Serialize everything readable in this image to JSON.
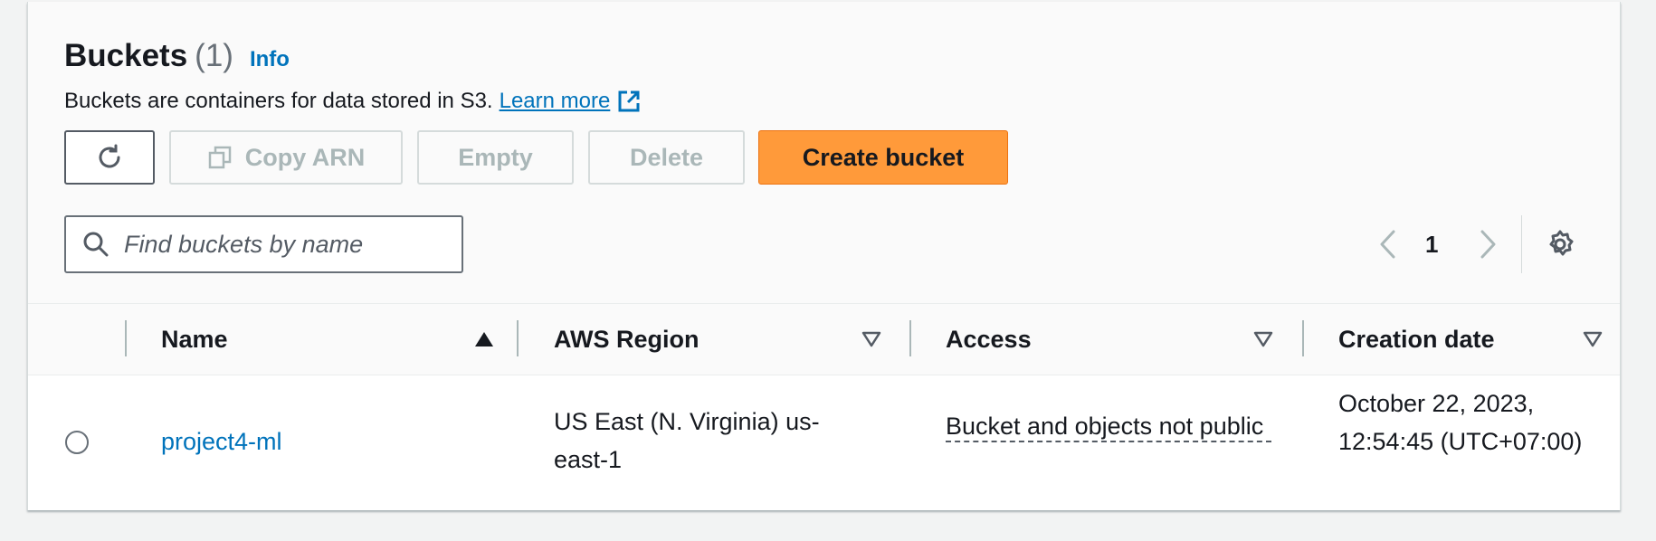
{
  "header": {
    "title": "Buckets",
    "count": "(1)",
    "info_link": "Info",
    "description": "Buckets are containers for data stored in S3.",
    "learn_more": "Learn more"
  },
  "toolbar": {
    "copy_arn_label": "Copy ARN",
    "empty_label": "Empty",
    "delete_label": "Delete",
    "create_label": "Create bucket"
  },
  "search": {
    "placeholder": "Find buckets by name",
    "value": ""
  },
  "pagination": {
    "current_page": "1"
  },
  "table": {
    "columns": [
      {
        "label": "Name",
        "sort": "ascending"
      },
      {
        "label": "AWS Region",
        "sort": "none"
      },
      {
        "label": "Access",
        "sort": "none"
      },
      {
        "label": "Creation date",
        "sort": "none"
      }
    ],
    "rows": [
      {
        "name": "project4-ml",
        "region": "US East (N. Virginia) us-east-1",
        "access": "Bucket and objects not public",
        "creation_date": "October 22, 2023, 12:54:45 (UTC+07:00)"
      }
    ]
  },
  "icons": {
    "refresh": "refresh-icon",
    "copy": "copy-icon",
    "external_link": "external-link-icon",
    "search": "search-icon",
    "prev": "chevron-left-icon",
    "next": "chevron-right-icon",
    "settings": "gear-icon",
    "sort_asc": "caret-up-filled-icon",
    "sort_none": "caret-down-outline-icon"
  },
  "colors": {
    "link": "#0073bb",
    "primary_button": "#ff9a3a",
    "disabled_text": "#aab7b8",
    "page_background": "#f2f3f3"
  }
}
